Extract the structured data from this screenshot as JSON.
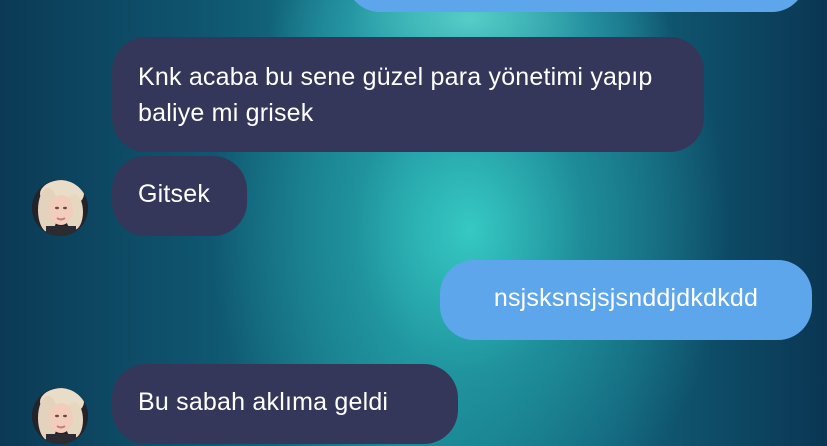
{
  "chat": {
    "messages": [
      {
        "sender": "other",
        "text": "Knk acaba bu sene güzel para yönetimi yapıp baliye mi grisek"
      },
      {
        "sender": "other",
        "text": "Gitsek"
      },
      {
        "sender": "me",
        "text": "nsjsksnsjsjsnddjdkdkdd"
      },
      {
        "sender": "other",
        "text": "Bu sabah aklıma geldi"
      }
    ]
  },
  "colors": {
    "incoming_bubble": "#34375a",
    "outgoing_bubble": "#5ea6ec",
    "text": "#ffffff"
  },
  "icons": {
    "avatar": "profile-photo"
  }
}
